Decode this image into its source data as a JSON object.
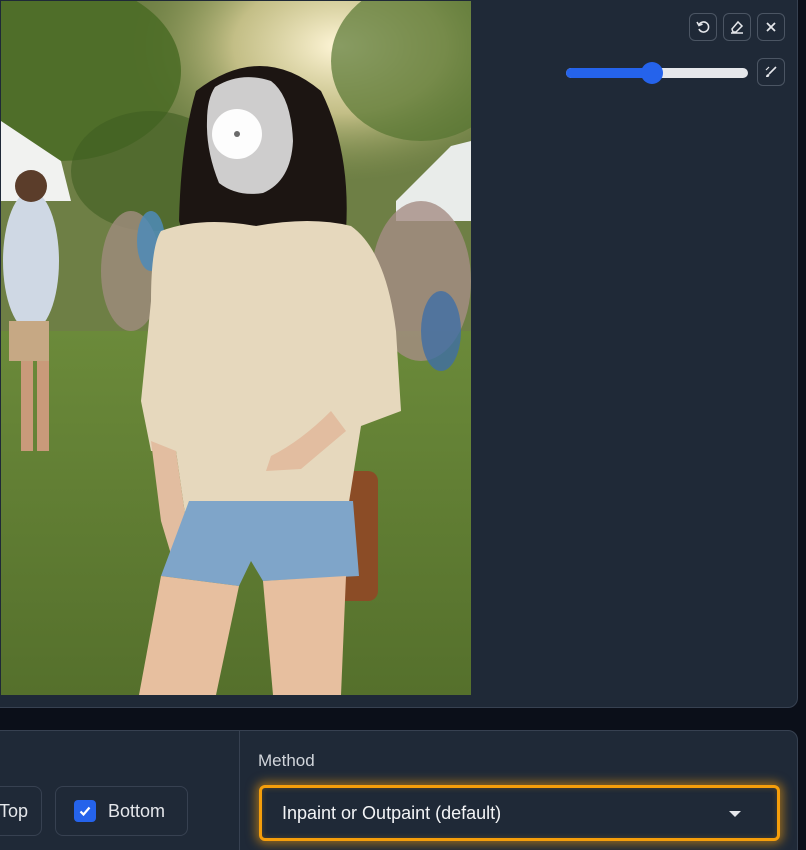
{
  "canvas": {
    "toolbar": {
      "undo_icon": "undo-icon",
      "eraser_icon": "eraser-icon",
      "close_icon": "close-icon",
      "brush_icon": "brush-icon"
    },
    "brush_size_slider": {
      "value_fraction": 0.47,
      "color": "#2563eb"
    }
  },
  "settings": {
    "crop_options": [
      {
        "label": "Top",
        "checked": false
      },
      {
        "label": "Bottom",
        "checked": true
      }
    ],
    "method": {
      "label": "Method",
      "selected": "Inpaint or Outpaint (default)",
      "highlight_color": "#f59e0b"
    }
  }
}
